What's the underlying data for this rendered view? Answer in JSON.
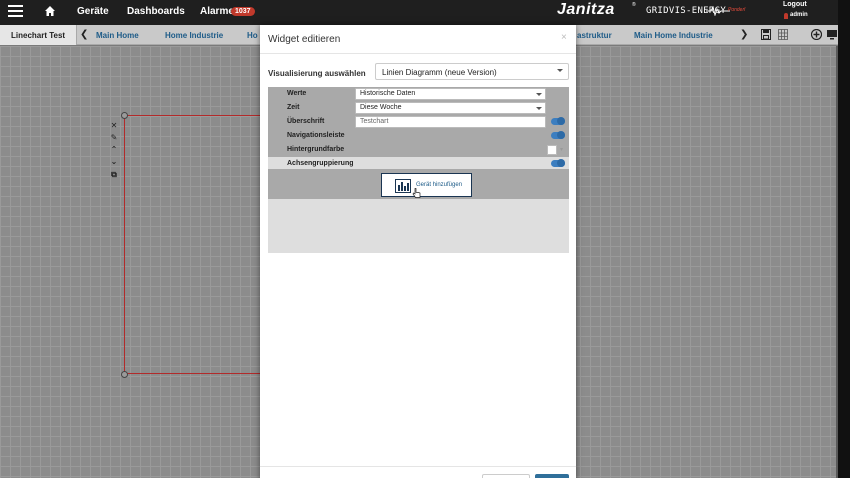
{
  "navbar": {
    "items": [
      "Geräte",
      "Dashboards",
      "Alarme"
    ],
    "alarm_count": "1037",
    "brand": "Janitza",
    "brand_mark": "®",
    "product": "GRIDVIS-ENERGY",
    "product_tag": "Ponderl",
    "logout": "Logout",
    "user": "admin"
  },
  "tabbar": {
    "current": "Linechart Test",
    "tabs": [
      "Main Home",
      "Home Industrie",
      "Ho",
      "astruktur",
      "Main Home Industrie"
    ],
    "prev_arrow": "❮",
    "next_arrow": "❯"
  },
  "widget_tools": {
    "icons": [
      "close-icon",
      "wrench-icon",
      "chevron-up-icon",
      "chevron-down-icon",
      "copy-icon"
    ],
    "glyphs": [
      "✕",
      "✎",
      "⌃",
      "⌄",
      "⧉"
    ]
  },
  "modal": {
    "title": "Widget editieren",
    "close": "×",
    "visualization_label": "Visualisierung auswählen",
    "visualization_value": "Linien Diagramm (neue Version)",
    "rows": [
      {
        "label": "Werte",
        "value": "Historische Daten",
        "type": "select"
      },
      {
        "label": "Zeit",
        "value": "Diese Woche",
        "type": "select"
      },
      {
        "label": "Überschrift",
        "value": "Testchart",
        "type": "input",
        "toggle": true
      },
      {
        "label": "Navigationsleiste",
        "type": "toggle",
        "toggle": true
      },
      {
        "label": "Hintergrundfarbe",
        "type": "color"
      },
      {
        "label": "Achsengruppierung",
        "type": "toggle",
        "toggle": true
      }
    ],
    "add_device_label": "Gerät hinzufügen"
  },
  "colors": {
    "accent": "#3c7ec0",
    "navbar_bg": "#1f1f1f",
    "alarm_badge": "#c0392b",
    "frame": "#b22a2a"
  }
}
